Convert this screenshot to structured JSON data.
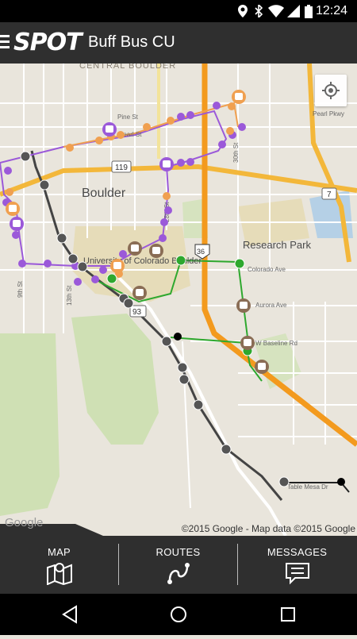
{
  "status": {
    "time": "12:24"
  },
  "header": {
    "logo_text": "SPOT",
    "title": "Buff Bus CU"
  },
  "map": {
    "labels": {
      "central_boulder": "CENTRAL BOULDER",
      "boulder": "Boulder",
      "research_park": "Research Park",
      "university": "University of Colorado Boulder",
      "pine_st": "Pine St",
      "pearl_st": "Pearl St",
      "pearl_pkwy": "Pearl Pkwy",
      "colorado_ave": "Colorado Ave",
      "aurora_ave": "Aurora Ave",
      "baseline_rd": "W Baseline Rd",
      "table_mesa": "Table Mesa Dr",
      "st_28": "28th St",
      "st_30": "30th St",
      "st_13": "13th St",
      "st_9": "9th St",
      "route_119": "119",
      "route_7": "7",
      "route_36": "36",
      "route_93": "93"
    },
    "attribution": "©2015 Google - Map data ©2015 Google",
    "google_logo": "Google"
  },
  "nav": {
    "map": "MAP",
    "routes": "ROUTES",
    "messages": "MESSAGES"
  },
  "colors": {
    "purple_route": "#9b59d9",
    "orange_route": "#f0a050",
    "green_route": "#2ea82e",
    "gray_route": "#555555",
    "highway": "#f3b73a",
    "interstate": "#f39a1e",
    "appbar": "#2f2f2f"
  }
}
